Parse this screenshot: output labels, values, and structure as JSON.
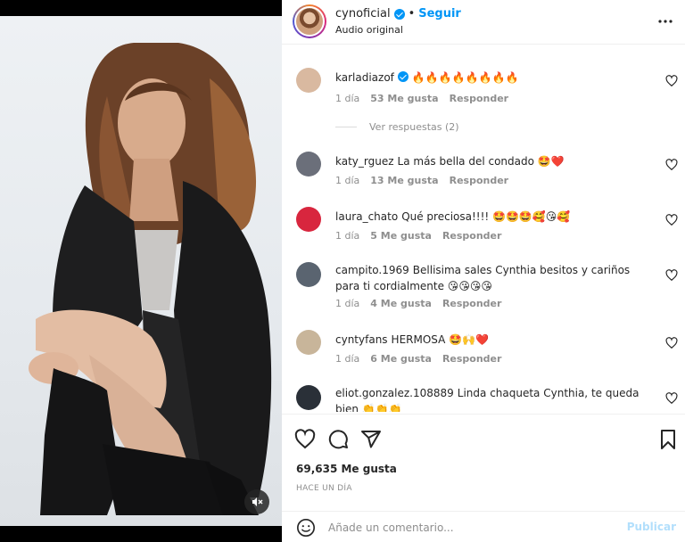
{
  "header": {
    "username": "cynoficial",
    "dot": "•",
    "follow_label": "Seguir",
    "audio_label": "Audio original"
  },
  "comments": [
    {
      "username": "karladiazof",
      "verified": true,
      "text": "🔥🔥🔥🔥🔥🔥🔥🔥",
      "time": "1 día",
      "likes": "53 Me gusta",
      "reply_label": "Responder",
      "view_replies": "Ver respuestas (2)",
      "avatar_color": "#d9b9a0"
    },
    {
      "username": "katy_rguez",
      "text": "La más bella del condado 🤩❤️",
      "time": "1 día",
      "likes": "13 Me gusta",
      "reply_label": "Responder",
      "avatar_color": "#6b6f7a"
    },
    {
      "username": "laura_chato",
      "text": "Qué preciosa!!!! 🤩🤩🤩🥰😘🥰",
      "time": "1 día",
      "likes": "5 Me gusta",
      "reply_label": "Responder",
      "avatar_color": "#d8263e"
    },
    {
      "username": "campito.1969",
      "text": "Bellisima sales Cynthia besitos y cariños para ti cordialmente 😘😘😘😘",
      "time": "1 día",
      "likes": "4 Me gusta",
      "reply_label": "Responder",
      "avatar_color": "#5a6470"
    },
    {
      "username": "cyntyfans",
      "text": "HERMOSA 🤩🙌❤️",
      "time": "1 día",
      "likes": "6 Me gusta",
      "reply_label": "Responder",
      "avatar_color": "#c8b59a"
    },
    {
      "username": "eliot.gonzalez.108889",
      "text": "Linda chaqueta Cynthia, te queda bien 👏👏👏",
      "avatar_color": "#2a3038"
    }
  ],
  "post": {
    "likes_count": "69,635 Me gusta",
    "date": "HACE UN DÍA"
  },
  "add_comment": {
    "placeholder": "Añade un comentario...",
    "publish_label": "Publicar"
  },
  "icons": {
    "more": "more-horizontal-icon",
    "like": "heart-icon",
    "comment": "comment-icon",
    "share": "send-icon",
    "save": "bookmark-icon",
    "emoji": "emoji-icon",
    "mute": "muted-speaker-icon"
  },
  "colors": {
    "accent": "#0095f6",
    "publish_disabled": "#b2dffc",
    "muted_text": "#8e8e8e"
  }
}
